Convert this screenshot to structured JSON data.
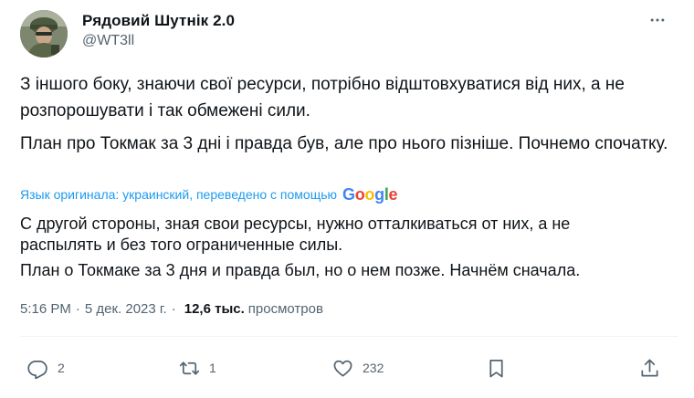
{
  "author": {
    "name": "Рядовий Шутнік 2.0",
    "handle": "@WT3ll"
  },
  "icons": {
    "more": "more-horizontal-icon",
    "reply": "reply-icon",
    "retweet": "retweet-icon",
    "like": "heart-icon",
    "bookmark": "bookmark-icon",
    "share": "share-icon"
  },
  "tweet": {
    "original_lines": [
      "З іншого боку, знаючи свої ресурси, потрібно відштовхуватися від них, а не розпорошувати і так обмежені сили.",
      "План про Токмак за 3 дні і правда був, але про нього пізніше. Почнемо спочатку."
    ],
    "translation_note": "Язык оригинала: украинский, переведено с помощью",
    "translation_provider": "Google",
    "translated_lines": [
      "С другой стороны, зная свои ресурсы, нужно отталкиваться от них, а не",
      "распылять и без того ограниченные силы.",
      "План о Токмаке за 3 дня и правда был, но о нем позже. Начнём сначала."
    ]
  },
  "meta": {
    "time": "5:16 PM",
    "separator": "·",
    "date": "5 дек. 2023 г.",
    "views_count": "12,6 тыс.",
    "views_label": "просмотров"
  },
  "actions": {
    "replies": "2",
    "retweets": "1",
    "likes": "232"
  },
  "colors": {
    "text": "#0f1419",
    "secondary": "#536471",
    "link": "#1d9bf0",
    "divider": "#eff3f4"
  }
}
